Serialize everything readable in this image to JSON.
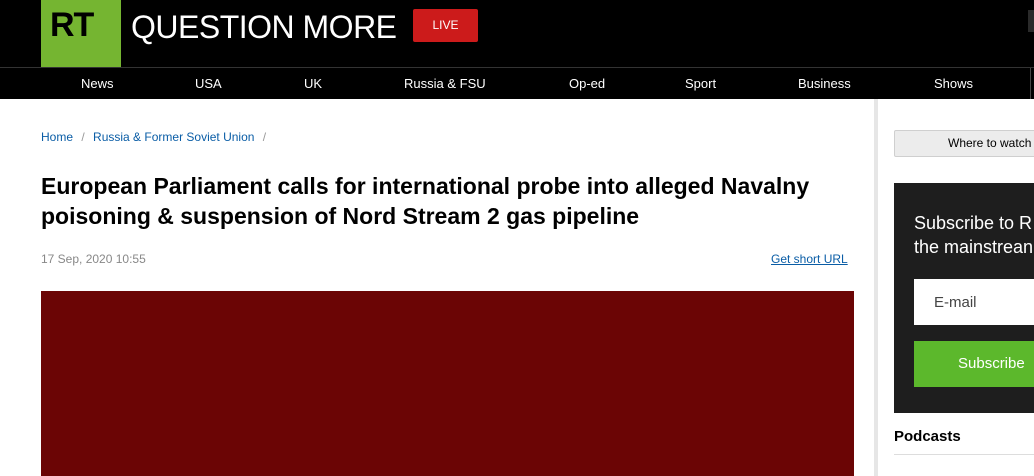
{
  "header": {
    "logo_text": "RT",
    "tagline": "QUESTION MORE",
    "live_label": "LIVE"
  },
  "nav": {
    "items": [
      "News",
      "USA",
      "UK",
      "Russia & FSU",
      "Op-ed",
      "Sport",
      "Business",
      "Shows"
    ]
  },
  "breadcrumb": {
    "items": [
      "Home",
      "Russia & Former Soviet Union"
    ],
    "separator": "/"
  },
  "article": {
    "headline": "European Parliament calls for international probe into alleged Navalny poisoning & suspension of Nord Stream 2 gas pipeline",
    "date": "17 Sep, 2020 10:55",
    "short_url_label": "Get short URL"
  },
  "sidebar": {
    "watch_label": "Where to watch",
    "subscribe_text_line1": "Subscribe to R",
    "subscribe_text_line2": "the mainstrean",
    "email_placeholder": "E-mail",
    "subscribe_button": "Subscribe",
    "podcasts_title": "Podcasts"
  },
  "colors": {
    "brand_green": "#75b531",
    "live_red": "#cc1b1b",
    "link_blue": "#0a5da6",
    "hero_red": "#6b0505",
    "subscribe_green": "#5cb82c"
  }
}
